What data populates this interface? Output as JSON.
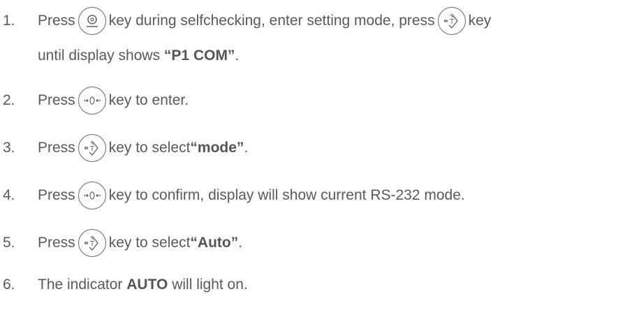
{
  "steps": [
    {
      "number": "1.",
      "pre": "Press",
      "key1": "menu-key",
      "mid": "key during selfchecking, enter setting mode, press",
      "key2": "tare-key",
      "post": "key",
      "line2_pre": "until display shows ",
      "line2_bold": "“P1  COM”",
      "line2_post": "."
    },
    {
      "number": "2.",
      "pre": "Press",
      "key": "zero-key",
      "post": "key to enter."
    },
    {
      "number": "3.",
      "pre": "Press",
      "key": "tare-key",
      "post": "key to select ",
      "bold": "“mode”",
      "end": "."
    },
    {
      "number": "4.",
      "pre": "Press",
      "key": "zero-key",
      "post": "key to confirm, display will show current RS-232 mode."
    },
    {
      "number": "5.",
      "pre": "Press",
      "key": "tare-key",
      "post": "key to select ",
      "bold": "“Auto”",
      "end": "."
    },
    {
      "number": "6.",
      "pre": "The indicator ",
      "bold": "AUTO",
      "post": " will light on."
    }
  ]
}
